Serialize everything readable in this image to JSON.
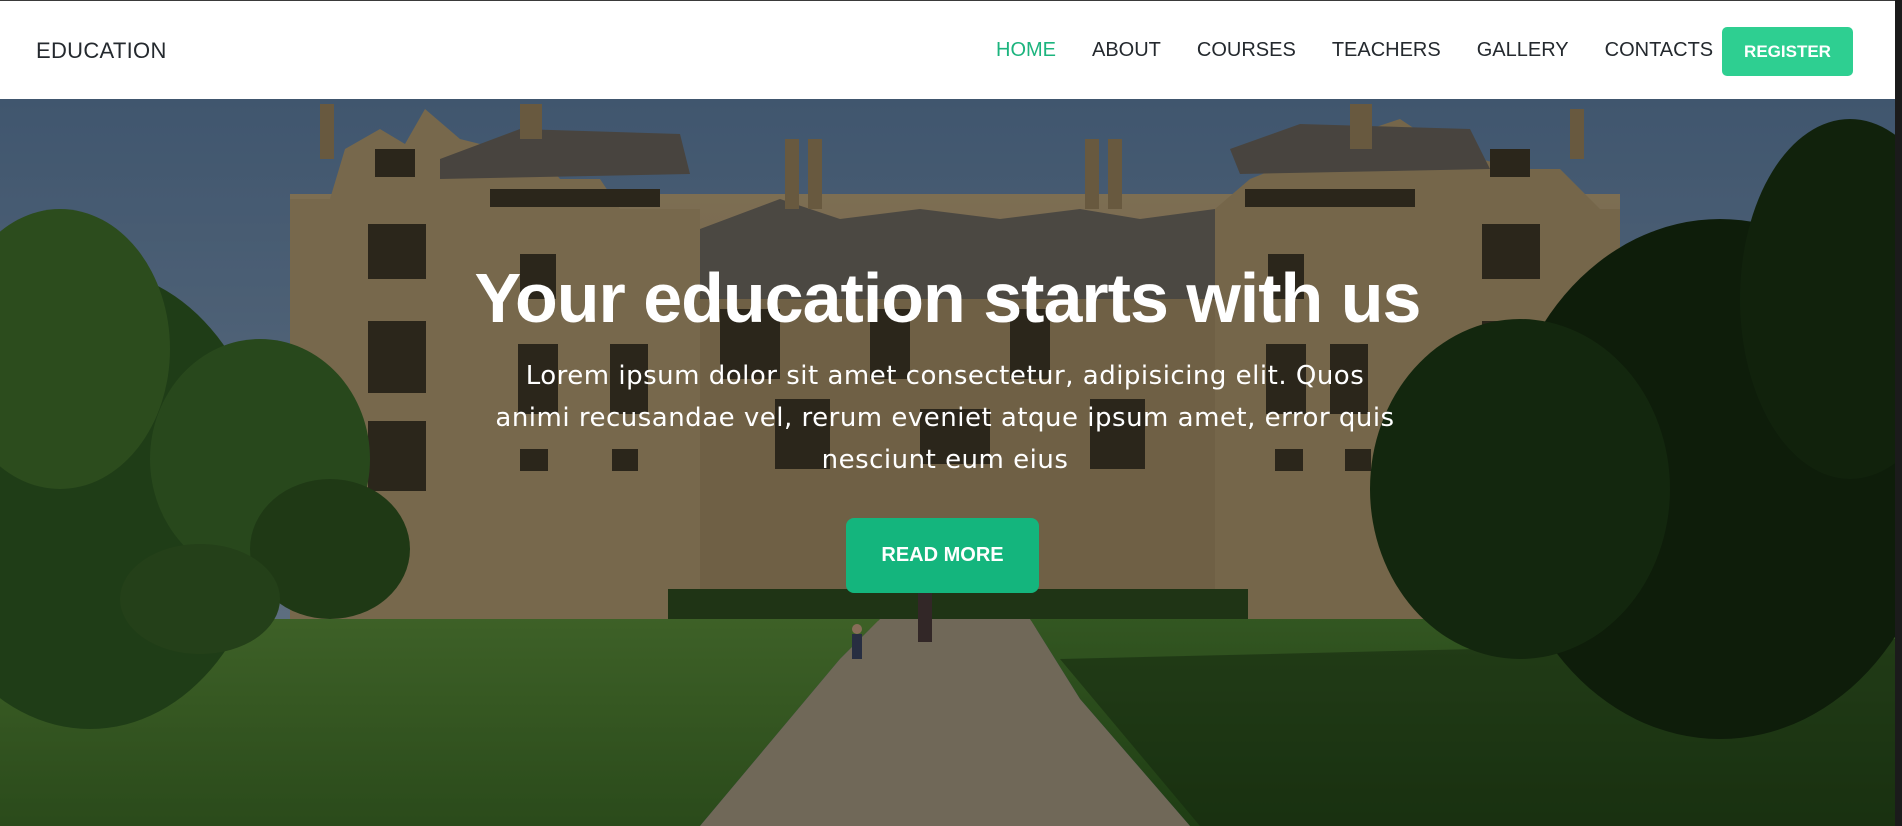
{
  "header": {
    "logo": "EDUCATION",
    "nav": [
      {
        "label": "HOME",
        "active": true
      },
      {
        "label": "ABOUT",
        "active": false
      },
      {
        "label": "COURSES",
        "active": false
      },
      {
        "label": "TEACHERS",
        "active": false
      },
      {
        "label": "GALLERY",
        "active": false
      },
      {
        "label": "CONTACTS",
        "active": false
      }
    ],
    "register_label": "REGISTER"
  },
  "hero": {
    "title": "Your education starts with us",
    "text": "Lorem ipsum dolor sit amet consectetur, adipisicing elit. Quos animi recusandae vel, rerum eveniet atque ipsum amet, error quis nesciunt eum eius",
    "button_label": "READ MORE",
    "background_image": "historic-manor-house-with-lawn"
  },
  "colors": {
    "accent": "#1cb47e",
    "register_bg": "#2ecf91",
    "read_more_bg": "#14b57d",
    "text_dark": "#24292e"
  }
}
